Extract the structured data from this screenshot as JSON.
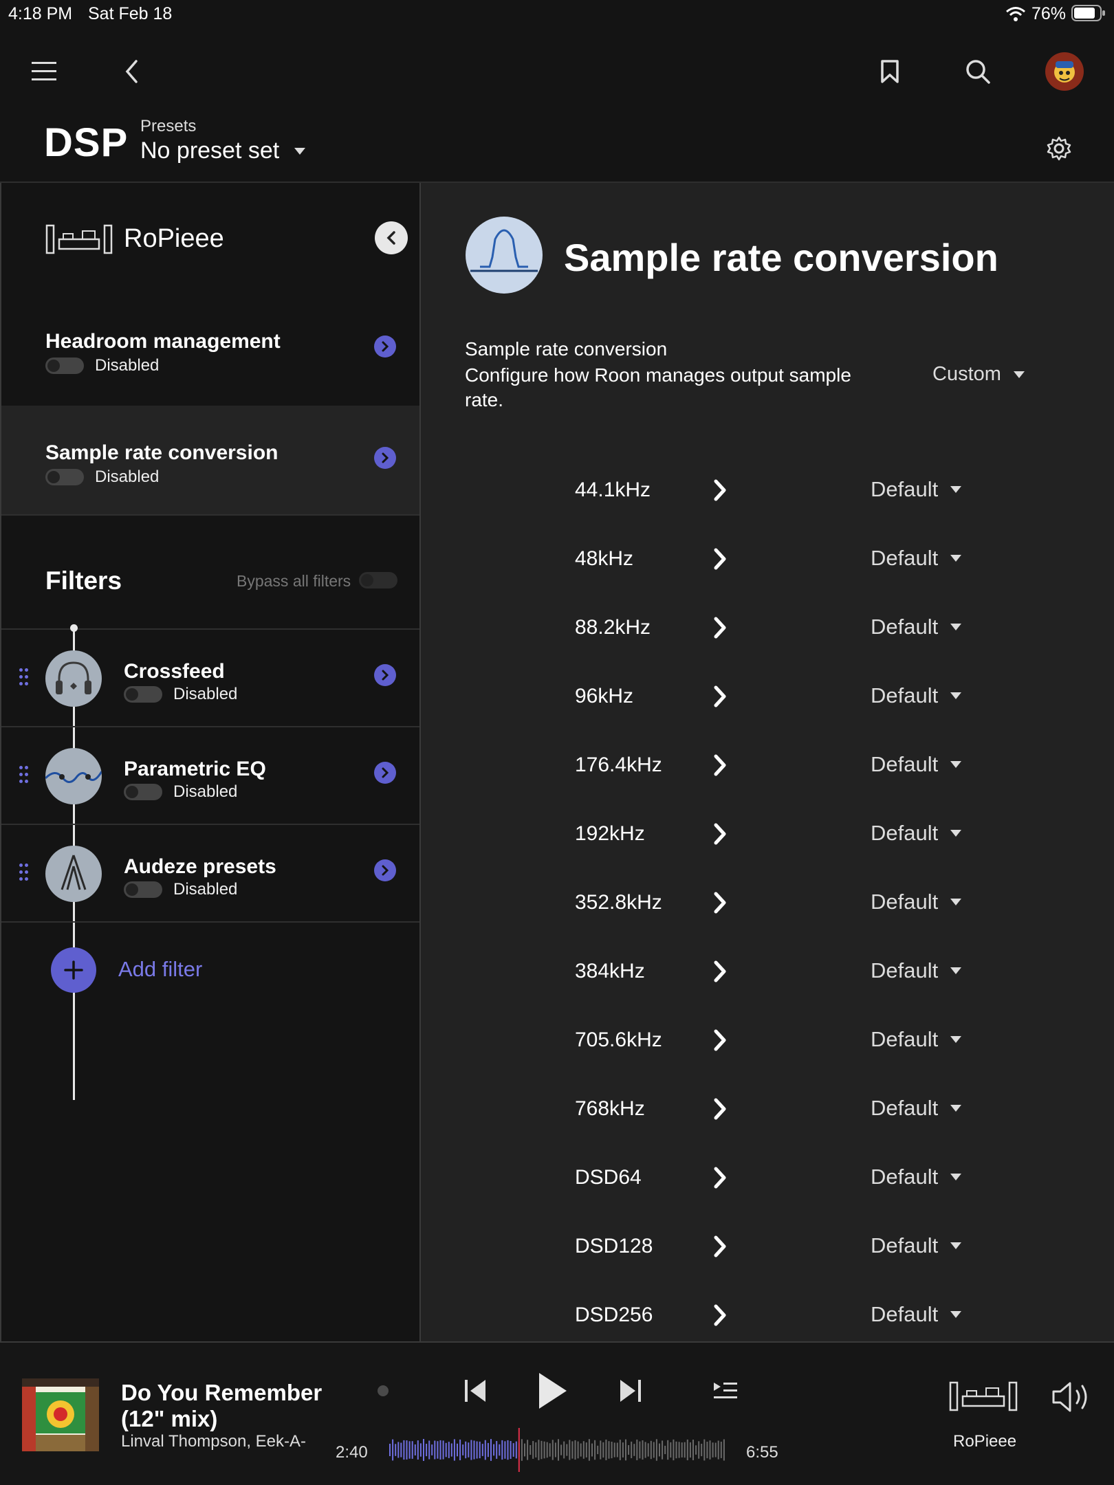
{
  "status": {
    "time": "4:18 PM",
    "date": "Sat Feb 18",
    "battery": "76%"
  },
  "header": {
    "title": "DSP",
    "presets_label": "Presets",
    "presets_value": "No preset set",
    "icons": [
      "menu-icon",
      "back-icon",
      "bookmark-icon",
      "search-icon",
      "avatar",
      "gear-icon"
    ]
  },
  "sidebar": {
    "zone": "RoPieee",
    "headroom": {
      "title": "Headroom management",
      "state": "Disabled"
    },
    "src": {
      "title": "Sample rate conversion",
      "state": "Disabled"
    },
    "filters_label": "Filters",
    "bypass_label": "Bypass all filters",
    "filters": [
      {
        "title": "Crossfeed",
        "state": "Disabled",
        "icon": "headphones-icon"
      },
      {
        "title": "Parametric EQ",
        "state": "Disabled",
        "icon": "eq-curve-icon"
      },
      {
        "title": "Audeze presets",
        "state": "Disabled",
        "icon": "audeze-logo-icon"
      }
    ],
    "add_filter": "Add filter"
  },
  "detail": {
    "title": "Sample rate conversion",
    "label": "Sample rate conversion",
    "description": "Configure how Roon manages output sample rate.",
    "mode": "Custom",
    "rates": [
      {
        "rate": "44.1kHz",
        "value": "Default"
      },
      {
        "rate": "48kHz",
        "value": "Default"
      },
      {
        "rate": "88.2kHz",
        "value": "Default"
      },
      {
        "rate": "96kHz",
        "value": "Default"
      },
      {
        "rate": "176.4kHz",
        "value": "Default"
      },
      {
        "rate": "192kHz",
        "value": "Default"
      },
      {
        "rate": "352.8kHz",
        "value": "Default"
      },
      {
        "rate": "384kHz",
        "value": "Default"
      },
      {
        "rate": "705.6kHz",
        "value": "Default"
      },
      {
        "rate": "768kHz",
        "value": "Default"
      },
      {
        "rate": "DSD64",
        "value": "Default"
      },
      {
        "rate": "DSD128",
        "value": "Default"
      },
      {
        "rate": "DSD256",
        "value": "Default"
      }
    ]
  },
  "player": {
    "track": "Do You Remember (12\" mix)",
    "artist": "Linval Thompson, Eek-A-Mouse",
    "elapsed": "2:40",
    "total": "6:55",
    "progress": 0.385,
    "zone": "RoPieee"
  },
  "colors": {
    "accent": "#5f5fcf",
    "background": "#141414",
    "panel": "#222222"
  }
}
